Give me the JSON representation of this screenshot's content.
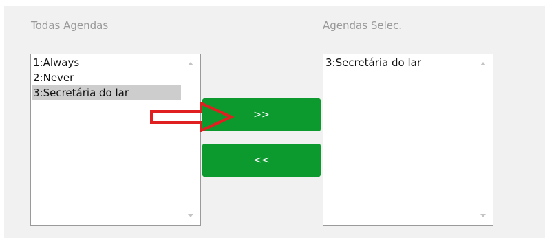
{
  "labels": {
    "all_agendas": "Todas Agendas",
    "selected_agendas": "Agendas Selec."
  },
  "all_agendas_list": [
    {
      "text": "1:Always",
      "selected": false
    },
    {
      "text": "2:Never",
      "selected": false
    },
    {
      "text": "3:Secretária do lar",
      "selected": true
    }
  ],
  "selected_agendas_list": [
    {
      "text": "3:Secretária do lar"
    }
  ],
  "buttons": {
    "add_label": ">>",
    "remove_label": "<<"
  },
  "colors": {
    "button_green": "#0c9a2e",
    "annotation_red": "#e02020",
    "selected_row": "#cdcdcd"
  },
  "icons": {
    "annotation": "red-arrow-icon",
    "scroll_up": "scroll-up-arrow-icon",
    "scroll_down": "scroll-down-arrow-icon"
  }
}
